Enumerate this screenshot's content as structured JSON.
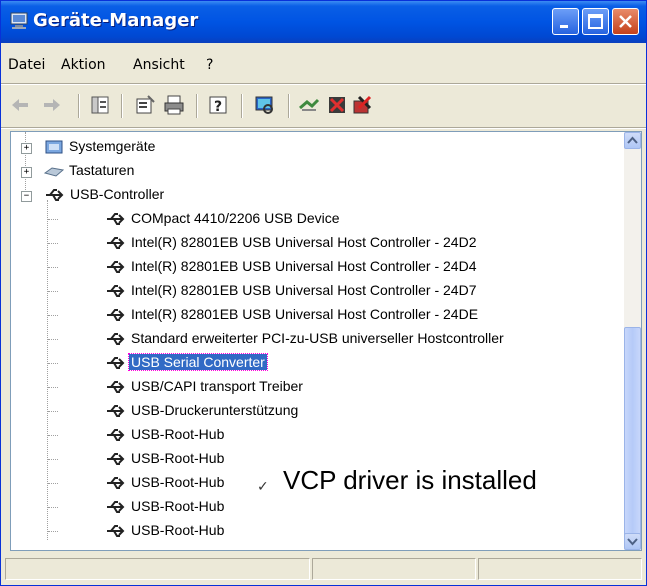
{
  "window": {
    "title": "Geräte-Manager"
  },
  "menu": [
    {
      "label": "Datei"
    },
    {
      "label": "Aktion"
    },
    {
      "label": "Ansicht"
    },
    {
      "label": "?"
    }
  ],
  "tree": {
    "rows": [
      {
        "label": "Systemgeräte"
      },
      {
        "label": "Tastaturen"
      },
      {
        "label": "USB-Controller"
      },
      {
        "label": "COMpact 4410/2206 USB Device"
      },
      {
        "label": "Intel(R) 82801EB USB Universal Host Controller - 24D2"
      },
      {
        "label": "Intel(R) 82801EB USB Universal Host Controller - 24D4"
      },
      {
        "label": "Intel(R) 82801EB USB Universal Host Controller - 24D7"
      },
      {
        "label": "Intel(R) 82801EB USB Universal Host Controller - 24DE"
      },
      {
        "label": "Standard erweiterter PCI-zu-USB universeller Hostcontroller"
      },
      {
        "label": "USB Serial Converter"
      },
      {
        "label": "USB/CAPI transport Treiber"
      },
      {
        "label": "USB-Druckerunterstützung"
      },
      {
        "label": "USB-Root-Hub"
      },
      {
        "label": "USB-Root-Hub"
      },
      {
        "label": "USB-Root-Hub"
      },
      {
        "label": "USB-Root-Hub"
      },
      {
        "label": "USB-Root-Hub"
      }
    ],
    "selected_label": "USB Serial Converter"
  },
  "annotation": {
    "text": "VCP driver is installed",
    "mark": "✓"
  },
  "colors": {
    "title_bar": "#0054e3",
    "selection": "#316ac5",
    "window_bg": "#ece9d8"
  }
}
